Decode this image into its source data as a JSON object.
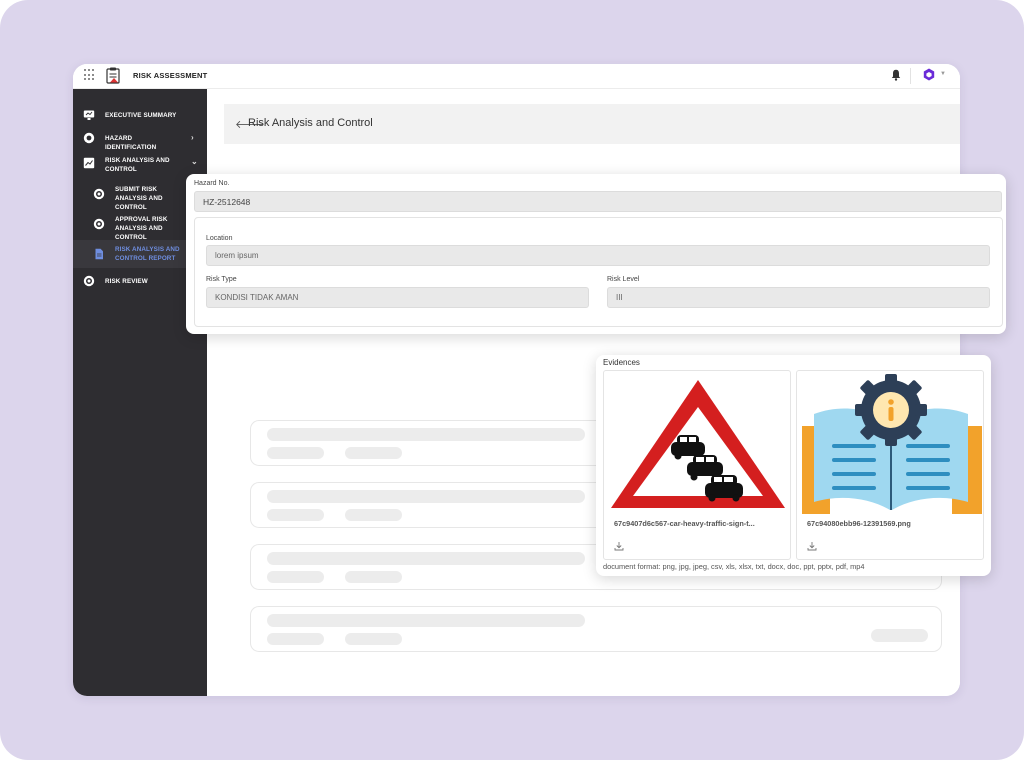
{
  "app": {
    "title": "RISK ASSESSMENT"
  },
  "sidebar": {
    "items": [
      {
        "label": "EXECUTIVE SUMMARY"
      },
      {
        "label": "HAZARD IDENTIFICATION"
      },
      {
        "label": "RISK ANALYSIS AND CONTROL"
      },
      {
        "label": "SUBMIT RISK ANALYSIS AND CONTROL"
      },
      {
        "label": "APPROVAL RISK ANALYSIS AND CONTROL"
      },
      {
        "label": "RISK ANALYSIS AND CONTROL REPORT"
      },
      {
        "label": "RISK REVIEW"
      }
    ]
  },
  "page": {
    "title": "Risk Analysis and Control"
  },
  "form": {
    "hazard_no_label": "Hazard No.",
    "hazard_no_value": "HZ-2512648",
    "location_label": "Location",
    "location_value": "lorem ipsum",
    "risk_type_label": "Risk Type",
    "risk_type_value": "KONDISI TIDAK AMAN",
    "risk_level_label": "Risk Level",
    "risk_level_value": "III"
  },
  "evidences": {
    "title": "Evidences",
    "files": [
      {
        "name": "67c9407d6c567-car-heavy-traffic-sign-t..."
      },
      {
        "name": "67c94080ebb96-12391569.png"
      }
    ],
    "format_note": "document format: png, jpg, jpeg, csv, xls, xlsx, txt, docx, doc, ppt, pptx, pdf, mp4"
  },
  "colors": {
    "sidebar_bg": "#2e2d31",
    "active_link": "#6f8ee0",
    "brand": "#6a2bd8",
    "backdrop": "#dcd5ec"
  },
  "icons": {
    "apps": "grid-icon",
    "brand": "clipboard-icon",
    "notifications": "bell-icon",
    "user": "hexagon-logo-icon",
    "back": "arrow-left-icon",
    "download": "download-icon"
  }
}
